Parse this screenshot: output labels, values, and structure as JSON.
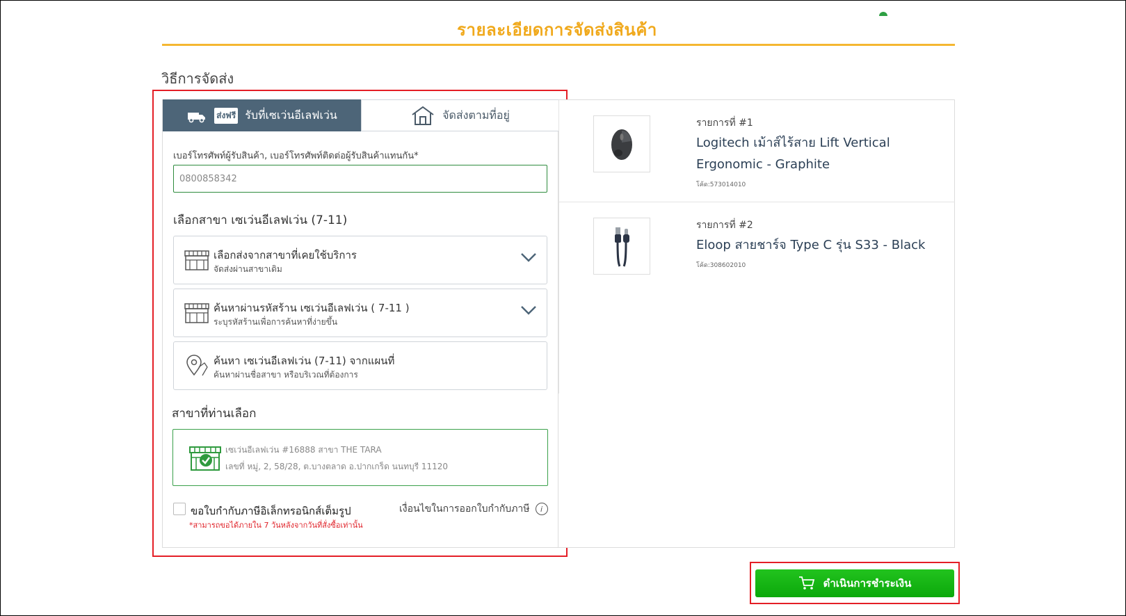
{
  "page": {
    "title": "รายละเอียดการจัดส่งสินค้า",
    "section_label": "วิธีการจัดส่ง"
  },
  "tabs": {
    "pickup": {
      "badge": "ส่งฟรี",
      "label": "รับที่เซเว่นอีเลฟเว่น",
      "icon": "truck-icon",
      "active": true
    },
    "delivery": {
      "label": "จัดส่งตามที่อยู่",
      "icon": "house-icon",
      "active": false
    }
  },
  "phone": {
    "label": "เบอร์โทรศัพท์ผู้รับสินค้า, เบอร์โทรศัพท์ติดต่อผู้รับสินค้าแทนกัน*",
    "value": "0800858342"
  },
  "branch": {
    "heading": "เลือกสาขา เซเว่นอีเลฟเว่น (7-11)",
    "options": [
      {
        "title": "เลือกส่งจากสาขาที่เคยใช้บริการ",
        "subtitle": "จัดส่งผ่านสาขาเดิม",
        "icon": "store-icon"
      },
      {
        "title": "ค้นหาผ่านรหัสร้าน เซเว่นอีเลฟเว่น ( 7-11 )",
        "subtitle": "ระบุรหัสร้านเพื่อการค้นหาที่ง่ายขึ้น",
        "icon": "store-icon"
      },
      {
        "title": "ค้นหา เซเว่นอีเลฟเว่น (7-11) จากแผนที่",
        "subtitle": "ค้นหาผ่านชื่อสาขา หรือบริเวณที่ต้องการ",
        "icon": "map-pin-icon"
      }
    ]
  },
  "selected": {
    "heading": "สาขาที่ท่านเลือก",
    "store_name": "เซเว่นอีเลฟเว่น #16888 สาขา THE TARA",
    "store_address": "เลขที่ หมู่, 2, 58/28, ต.บางตลาด อ.ปากเกร็ด นนทบุรี 11120"
  },
  "tax": {
    "label": "ขอใบกำกับภาษีอิเล็กทรอนิกส์เต็มรูป",
    "note": "*สามารถขอได้ภายใน 7 วันหลังจากวันที่สั่งซื้อเท่านั้น",
    "condition": "เงื่อนไขในการออกใบกำกับภาษี",
    "checked": false
  },
  "items": [
    {
      "number": "รายการที่ #1",
      "name": "Logitech เม้าส์ไร้สาย Lift Vertical Ergonomic - Graphite",
      "code": "โค้ด:573014010",
      "image": "mouse"
    },
    {
      "number": "รายการที่ #2",
      "name": "Eloop สายชาร์จ Type C รุ่น S33 - Black",
      "code": "โค้ด:308602010",
      "image": "usb-cable"
    }
  ],
  "pay_button": {
    "label": "ดำเนินการชำระเงิน",
    "icon": "cart-icon"
  },
  "colors": {
    "title": "#f0a91c",
    "active_tab": "#4d6578",
    "green_border": "#3aa04a",
    "pay_button": "#19b819",
    "highlight_box": "#e41e26",
    "note_red": "#e0232a"
  }
}
